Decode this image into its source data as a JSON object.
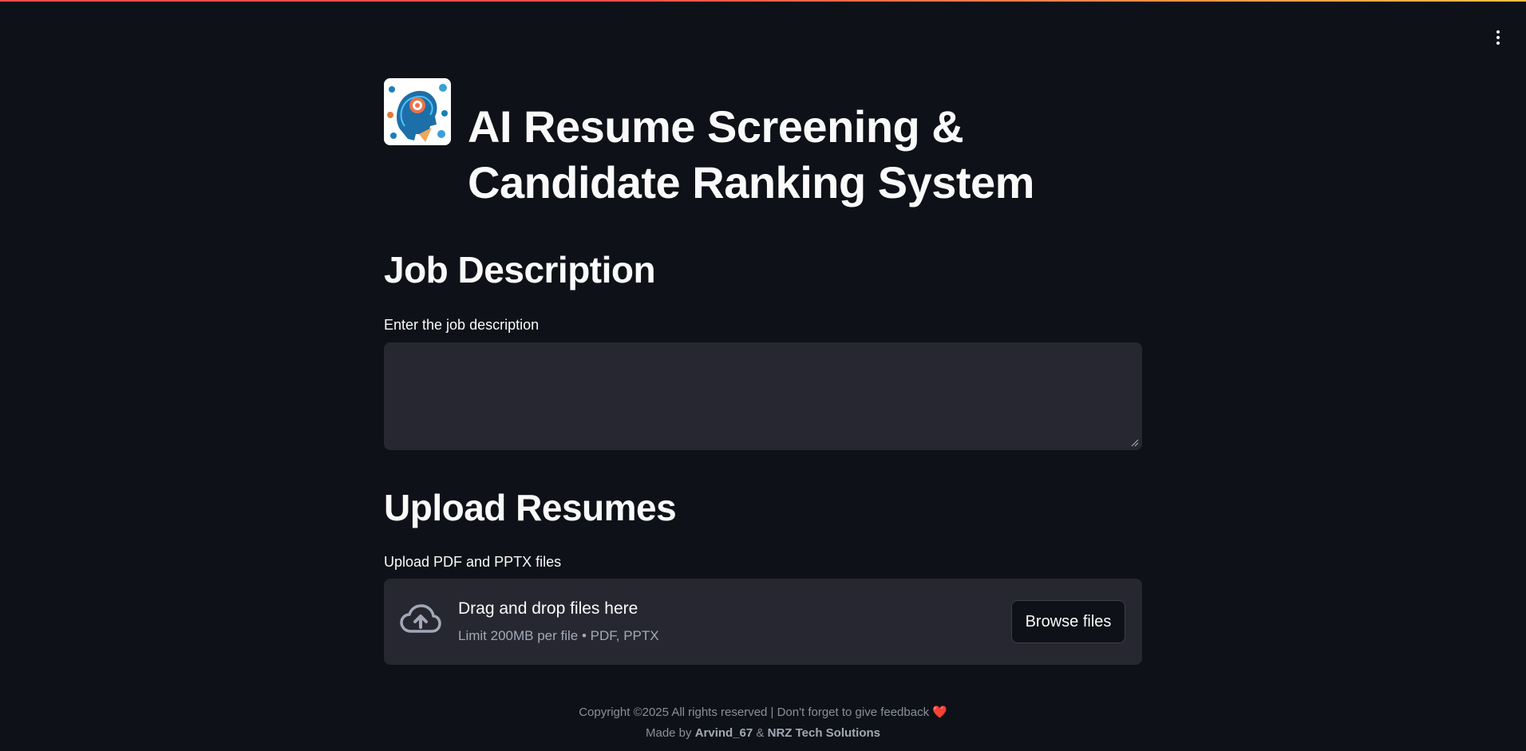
{
  "app": {
    "title_line1": "AI Resume Screening &",
    "title_line2": "Candidate Ranking System",
    "logo_icon": "brain-head-icon",
    "accent_color": "#ff4b4b",
    "background_color": "#0e1117",
    "surface_color": "#262730"
  },
  "toolbar": {
    "menu_icon": "kebab-menu-icon"
  },
  "job_section": {
    "heading": "Job Description",
    "input_label": "Enter the job description",
    "input_value": "",
    "placeholder": ""
  },
  "upload_section": {
    "heading": "Upload Resumes",
    "input_label": "Upload PDF and PPTX files",
    "dropzone_title": "Drag and drop files here",
    "dropzone_limit": "Limit 200MB per file • PDF, PPTX",
    "browse_label": "Browse files",
    "upload_icon": "cloud-upload-icon"
  },
  "footer": {
    "copyright": "Copyright ©2025 All rights reserved | Don't forget to give feedback",
    "heart": "❤️",
    "made_by_prefix": "Made by",
    "author": "Arvind_67",
    "and": "&",
    "company": "NRZ Tech Solutions"
  }
}
